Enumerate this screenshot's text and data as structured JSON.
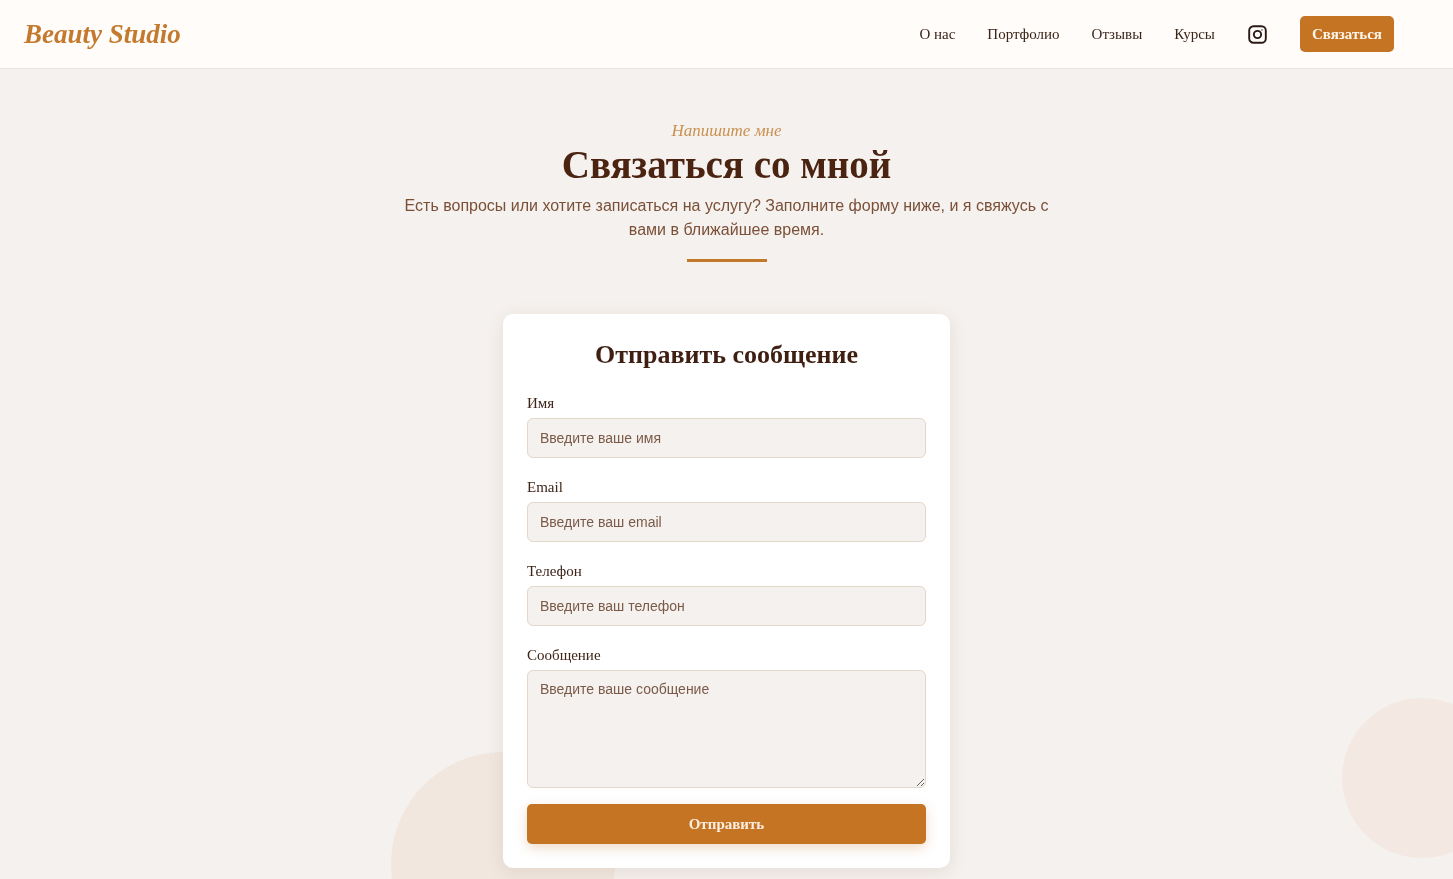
{
  "header": {
    "logo": "Beauty Studio",
    "nav": [
      "О нас",
      "Портфолио",
      "Отзывы",
      "Курсы"
    ],
    "cta": "Связаться"
  },
  "hero": {
    "eyebrow": "Напишите мне",
    "title": "Связаться со мной",
    "description": "Есть вопросы или хотите записаться на услугу? Заполните форму ниже, и я свяжусь с вами в ближайшее время."
  },
  "form": {
    "title": "Отправить сообщение",
    "fields": [
      {
        "kind": "input",
        "label": "Имя",
        "placeholder": "Введите ваше имя"
      },
      {
        "kind": "input",
        "label": "Email",
        "placeholder": "Введите ваш email"
      },
      {
        "kind": "input",
        "label": "Телефон",
        "placeholder": "Введите ваш телефон"
      },
      {
        "kind": "textarea",
        "label": "Сообщение",
        "placeholder": "Введите ваше сообщение"
      }
    ],
    "submit": "Отправить"
  }
}
